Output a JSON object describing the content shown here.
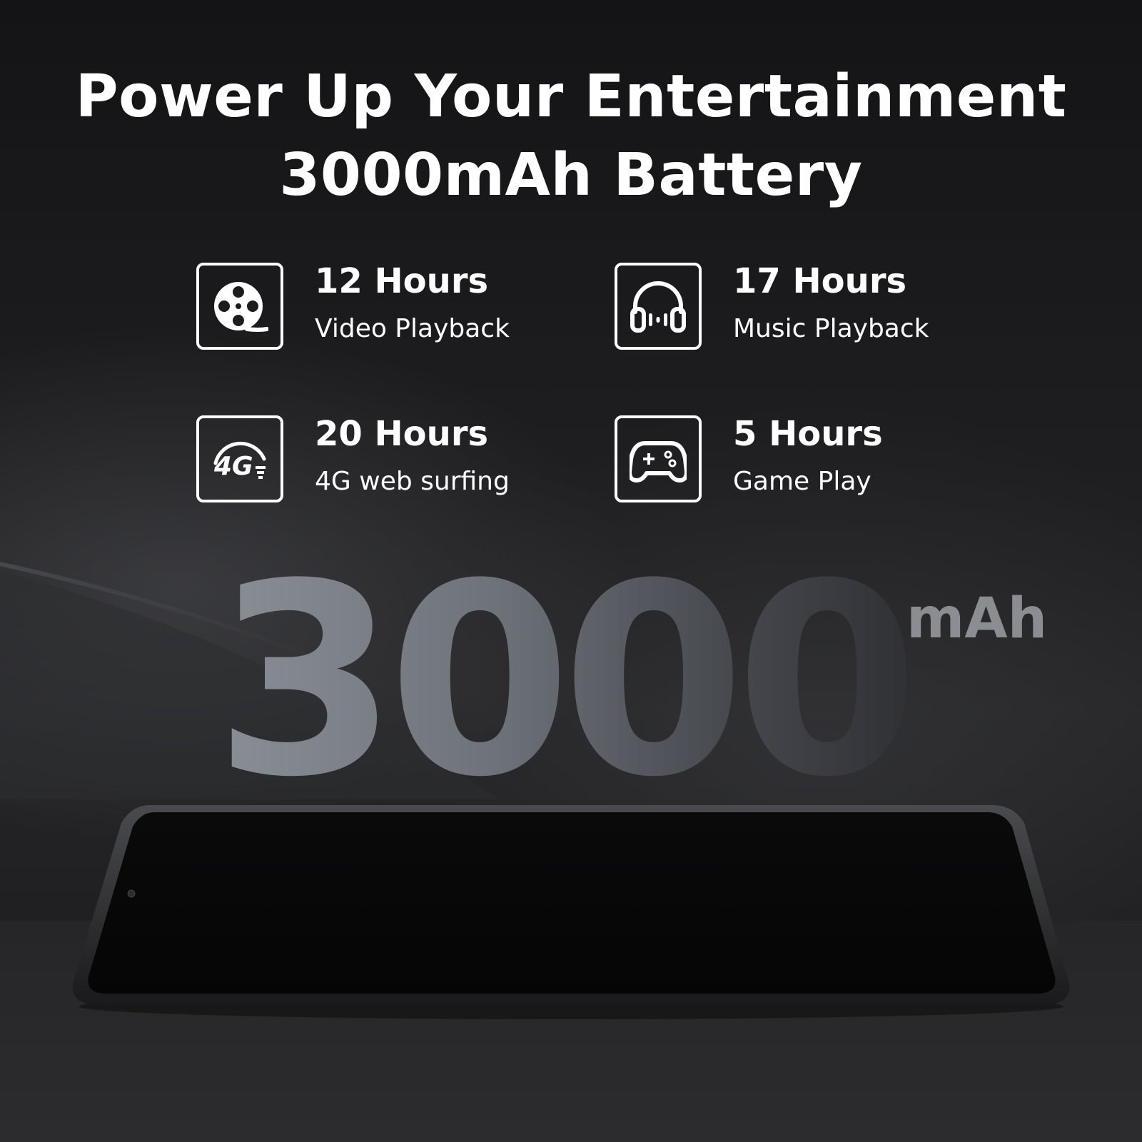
{
  "headline": {
    "line1": "Power Up Your Entertainment",
    "line2": "3000mAh Battery"
  },
  "features": [
    {
      "hours": "12 Hours",
      "label": "Video Playback",
      "icon": "film-reel-icon"
    },
    {
      "hours": "17 Hours",
      "label": "Music Playback",
      "icon": "headphones-icon"
    },
    {
      "hours": "20 Hours",
      "label": "4G web surfing",
      "icon": "4g-signal-icon"
    },
    {
      "hours": "5 Hours",
      "label": "Game Play",
      "icon": "gamepad-icon"
    }
  ],
  "capacity": {
    "number": "3000",
    "unit": "mAh"
  },
  "colors": {
    "background": "#1c1c1e",
    "text": "#ffffff",
    "big_number": "#7c8188",
    "unit": "#8a8d92"
  }
}
